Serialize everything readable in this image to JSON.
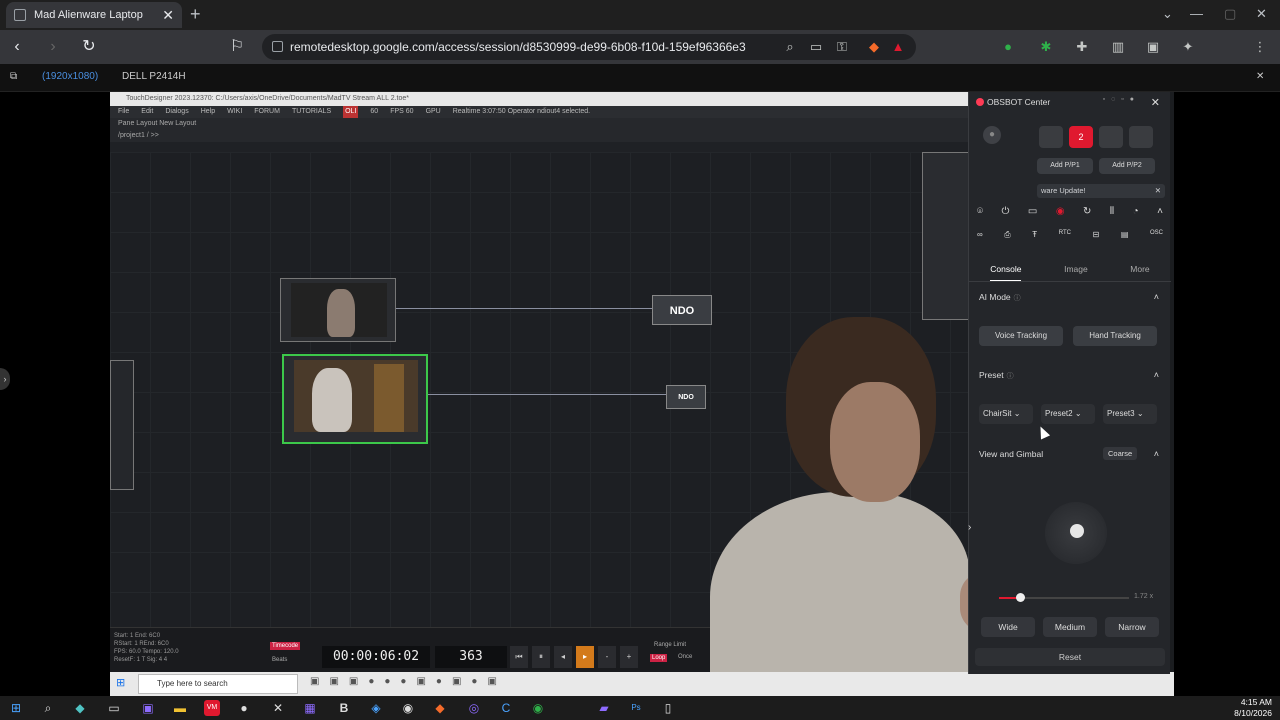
{
  "browser": {
    "tab_title": "Mad Alienware Laptop",
    "url": "remotedesktop.google.com/access/session/d8530999-de99-6b08-f10d-159ef96366e3"
  },
  "remote_bar": {
    "tabs": [
      {
        "label": "(1920x1080)",
        "active": true
      },
      {
        "label": "DELL P2414H",
        "active": false
      }
    ]
  },
  "touchdesigner": {
    "title": "TouchDesigner 2023.12370: C:/Users/axis/OneDrive/Documents/MadTV Stream ALL 2.toe*",
    "menu": [
      "File",
      "Edit",
      "Dialogs",
      "Help",
      "WIKI",
      "FORUM",
      "TUTORIALS",
      "OLI",
      "60",
      "FPS 60",
      "GPU",
      "Realtime 3:07:50 Operator ndiout4 selected."
    ],
    "layout_row": "Pane Layout   New Layout",
    "path": "/project1 / >>",
    "ndo_label_1": "NDO",
    "ndo_label_2": "NDO",
    "timecode": "00:00:06:02",
    "frame": "363",
    "stats": [
      "Start: 1  End: 6C0",
      "RStart: 1  REnd: 6C0",
      "FPS: 60.0  Tempo: 120.0",
      "ResetF: 1  T Sig: 4 4"
    ],
    "timecode_label": "Timecode",
    "beats_label": "Beats",
    "range_label": "Range Limit",
    "loop_label": "Loop",
    "once_label": "Once"
  },
  "remote_taskbar": {
    "search_placeholder": "Type here to search",
    "time": "4:15 AM",
    "date": "8/10/2026"
  },
  "obsbot": {
    "title": "OBSBOT Center",
    "slot_active": "2",
    "add_p1": "Add P/P1",
    "add_p2": "Add P/P2",
    "banner": "ware Update!",
    "tabs": [
      "Console",
      "Image",
      "More"
    ],
    "ai_mode": "AI Mode",
    "voice_tracking": "Voice Tracking",
    "hand_tracking": "Hand Tracking",
    "preset": "Preset",
    "presets": [
      "ChairSit",
      "Preset2",
      "Preset3"
    ],
    "view_gimbal": "View and Gimbal",
    "coarse": "Coarse",
    "zoom_value": "1.72 x",
    "zoom_level": 0.16,
    "fov": [
      "Wide",
      "Medium",
      "Narrow"
    ],
    "reset": "Reset",
    "icons_row1": [
      "camera-icon",
      "power-icon",
      "record-icon",
      "tracking-icon",
      "refresh-icon",
      "audio-icon",
      "timer-icon",
      "chevron-up-icon"
    ],
    "icons_row2": [
      "link-icon",
      "print-icon",
      "text-icon",
      "rtc-label",
      "lock-icon",
      "card-icon",
      "osc-label"
    ],
    "rtc": "RTC",
    "osc": "OSC"
  },
  "taskbar": {
    "time": "4:15 AM",
    "date": "8/10/2026"
  },
  "colors": {
    "accent_red": "#e0192f",
    "chrome_dark": "#35363a",
    "remote_blue": "#4a8fe0",
    "td_bg": "#1d1f23"
  }
}
